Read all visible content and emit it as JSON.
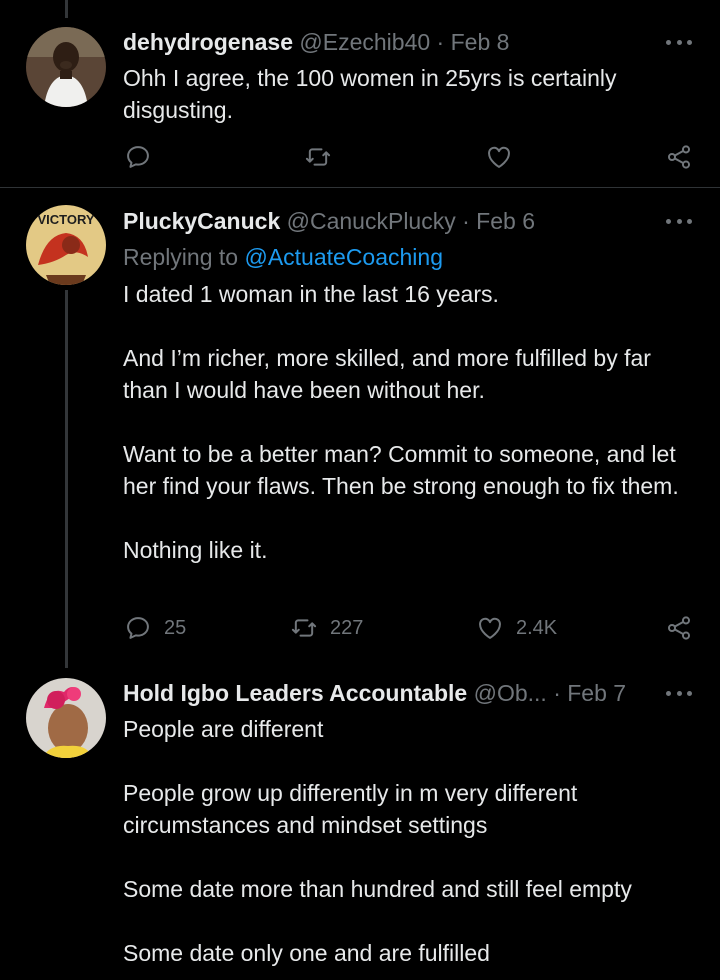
{
  "tweets": [
    {
      "name": "dehydrogenase",
      "handle": "@Ezechib40",
      "separator": "·",
      "date": "Feb 8",
      "body": [
        "Ohh I agree, the 100 women in 25yrs is certainly disgusting."
      ],
      "stats": {
        "replies": "",
        "retweets": "",
        "likes": ""
      }
    },
    {
      "name": "PluckyCanuck",
      "handle": "@CanuckPlucky",
      "separator": "·",
      "date": "Feb 6",
      "replying_prefix": "Replying to",
      "replying_to": "@ActuateCoaching",
      "avatar_text": "VICTORY",
      "body": [
        "I dated 1 woman in the last 16 years.",
        "And I’m richer, more skilled, and more fulfilled by far than I would have been without her.",
        "Want to be a better man? Commit to someone, and let her find your flaws. Then be strong enough to fix them.",
        "Nothing like it."
      ],
      "stats": {
        "replies": "25",
        "retweets": "227",
        "likes": "2.4K"
      }
    },
    {
      "name": "Hold Igbo Leaders Accountable",
      "handle": "@Ob...",
      "separator": "·",
      "date": "Feb 7",
      "body": [
        "People are different",
        "People grow up differently in m very different circumstances and mindset settings",
        "Some date more than hundred and still feel empty",
        "Some date only one and are fulfilled"
      ]
    }
  ],
  "icons": {
    "reply": "reply-icon",
    "retweet": "retweet-icon",
    "like": "heart-icon",
    "share": "share-icon",
    "more": "more-icon"
  },
  "colors": {
    "background": "#000000",
    "text": "#e7e9ea",
    "muted": "#71767b",
    "link": "#1d9bf0"
  }
}
